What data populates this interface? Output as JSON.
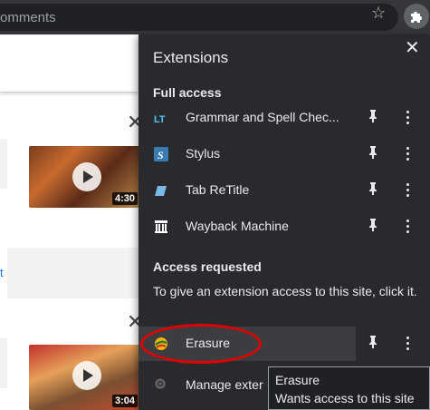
{
  "browser": {
    "omnibox_text": "omments"
  },
  "page": {
    "left_link": "t",
    "video1_duration": "4:30",
    "video2_duration": "3:04"
  },
  "extensions": {
    "title": "Extensions",
    "full_access_heading": "Full access",
    "full_access_items": [
      {
        "label": "Grammar and Spell Chec...",
        "icon": "grammar-icon"
      },
      {
        "label": "Stylus",
        "icon": "stylus-icon"
      },
      {
        "label": "Tab ReTitle",
        "icon": "tab-retitle-icon"
      },
      {
        "label": "Wayback Machine",
        "icon": "wayback-machine-icon"
      }
    ],
    "access_requested_heading": "Access requested",
    "access_hint": "To give an extension access to this site, click it.",
    "requested_items": [
      {
        "label": "Erasure",
        "icon": "erasure-icon"
      }
    ],
    "manage_label": "Manage exter"
  },
  "tooltip": {
    "title": "Erasure",
    "text": "Wants access to this site"
  },
  "colors": {
    "popup_bg": "#292a2d",
    "highlight_ellipse": "#e00000",
    "link": "#1a73e8"
  }
}
